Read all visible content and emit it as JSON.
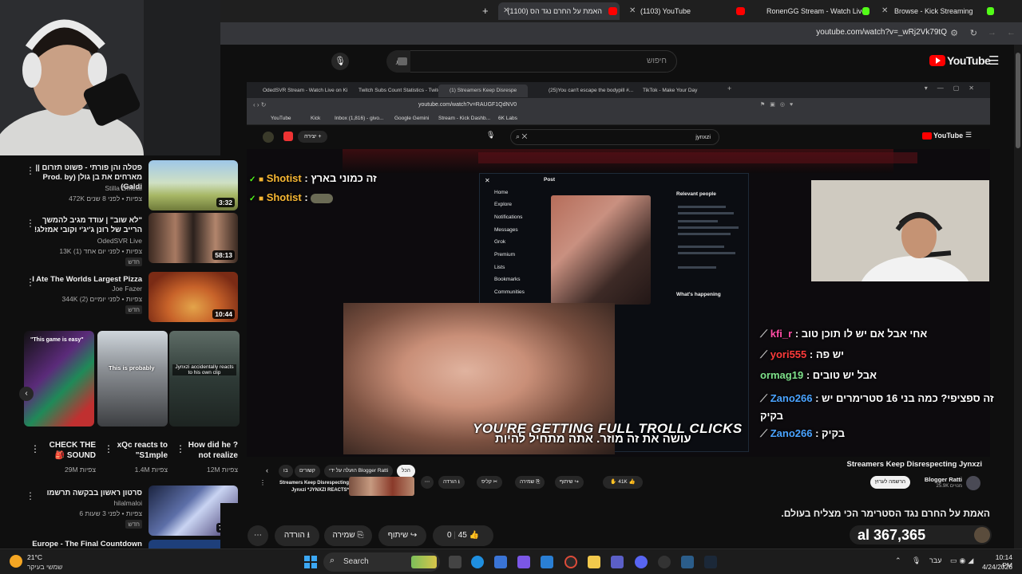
{
  "tabs": [
    {
      "label": "האמת על החרם נגד הס (1100)",
      "active": true
    },
    {
      "label": "(1103) YouTube",
      "active": false
    },
    {
      "label": "RonenGG Stream - Watch Live",
      "active": false
    },
    {
      "label": "Browse - Kick Streaming",
      "active": false
    }
  ],
  "address": {
    "url": "youtube.com/watch?v=_wRj2Vk79tQ"
  },
  "yt": {
    "logo": "YouTube",
    "search_placeholder": "חיפוש"
  },
  "sidebar": {
    "videos": [
      {
        "title": "פטלה והן פורתי - פשוט תזרום || מארחים את בן גולן (Prod. by Galdi)",
        "channel": "Stilla Official",
        "meta": "472K צפיות • לפני 8 שנים",
        "duration": "3:32",
        "new": ""
      },
      {
        "title": "\"לא שוב\" | עודד מגיב להמשך הרייב של רונן ג'יג'י וקובי אמזלג!",
        "channel": "OdedSVR Live",
        "meta": "13K צפיות • לפני יום אחד (1)",
        "duration": "58:13",
        "new": "חדש"
      },
      {
        "title": "I Ate The Worlds Largest Pizza",
        "channel": "Joe Fazer",
        "meta": "344K צפיות • לפני יומיים (2)",
        "duration": "10:44",
        "new": "חדש"
      },
      {
        "title": "סרטון ראשון בבקשה תרשמו",
        "channel": "hilalmaloi",
        "meta": "6 צפיות • לפני 3 שעות",
        "duration": "7:12",
        "new": "חדש"
      },
      {
        "title": "Europe - The Final Countdown",
        "channel": "",
        "meta": "",
        "duration": "",
        "new": ""
      }
    ],
    "shorts": [
      {
        "title": "CHECK THE 🎒 SOUND",
        "views": "29M צפיות",
        "caption": "\"This game is easy\""
      },
      {
        "title": "xQc reacts to \"S1mple",
        "views": "1.4M צפיות",
        "caption": "This is probably"
      },
      {
        "title": "How did he ?not realize",
        "views": "12M צפיות",
        "caption": "Jynxzi accidentally reacts to his own clip"
      }
    ]
  },
  "inner": {
    "tabs": [
      "OdedSVR Stream - Watch Live on Ki",
      "Twitch Subs Count Statistics - Twitch",
      "(1) Streamers Keep Disrespe",
      "(25)You can't escape the bodypill #...",
      "TikTok - Make Your Day"
    ],
    "url": "youtube.com/watch?v=RAUGF1QdNV0",
    "bookmarks": [
      "YouTube",
      "Kick",
      "Inbox (1,816) - givo...",
      "Google Gemini",
      "Stream - Kick Dashb...",
      "6K Labs"
    ],
    "search_text": "jynxzi",
    "create_label": "יצירה",
    "x_nav": [
      "Home",
      "Explore",
      "Notifications",
      "Messages",
      "Grok",
      "Premium",
      "Lists",
      "Bookmarks",
      "Communities"
    ],
    "x_post_title": "Post",
    "x_relevant": "Relevant people",
    "x_happening": "What's happening",
    "title": "Streamers Keep Disrespecting Jynxzi",
    "channel": "Blogger Ratti",
    "subs": "25.9K מנויים",
    "subscribe": "הרשמה לערוץ",
    "likes": "41K",
    "share": "שיתוף",
    "save": "שמירה",
    "clip": "קליפ",
    "download": "הורדה",
    "chips": [
      "הכל",
      "הועלה על ידי Blogger Ratti",
      "קשורים",
      "בו"
    ],
    "mini_title": "Streamers Keep Disrespecting Jynxzi *JYNXZI REACTS*"
  },
  "chat": [
    {
      "name": "Shotist",
      "text": "זה כמוני בארץ"
    },
    {
      "name": "Shotist",
      "text": ""
    },
    {
      "name": "kfi_r",
      "text": "אחי אבל אם יש לו תוכן טוב"
    },
    {
      "name": "yori555",
      "text": "יש פה"
    },
    {
      "name": "ormag19",
      "text": "אבל יש טובים"
    },
    {
      "name": "Zano266",
      "text": "זה ספציפי? כמה בני 16 סטרימרים יש בקיק"
    },
    {
      "name": "Zano266",
      "text": "בקיק"
    }
  ],
  "subtitles": {
    "english": "YOU'RE GETTING FULL TROLL CLICKS",
    "hebrew": "עושה את זה מוזר. אתה מתחיל להיות"
  },
  "video": {
    "title": "האמת על החרם נגד הסטרימר הכי מצליח בעולם.",
    "likes": "45",
    "dislikes": "0",
    "share": "שיתוף",
    "save": "שמירה",
    "download": "הורדה",
    "overlay_text": "al 367,365"
  },
  "taskbar": {
    "weather_temp": "21°C",
    "weather_desc": "שמשי בעיקר",
    "search": "Search",
    "lang": "עבר",
    "time": "10:14 PM",
    "date": "4/24/2026"
  },
  "colors": {
    "yt_red": "#ff0000",
    "kick_green": "#53fc18",
    "chat_gold": "#f7b733"
  }
}
